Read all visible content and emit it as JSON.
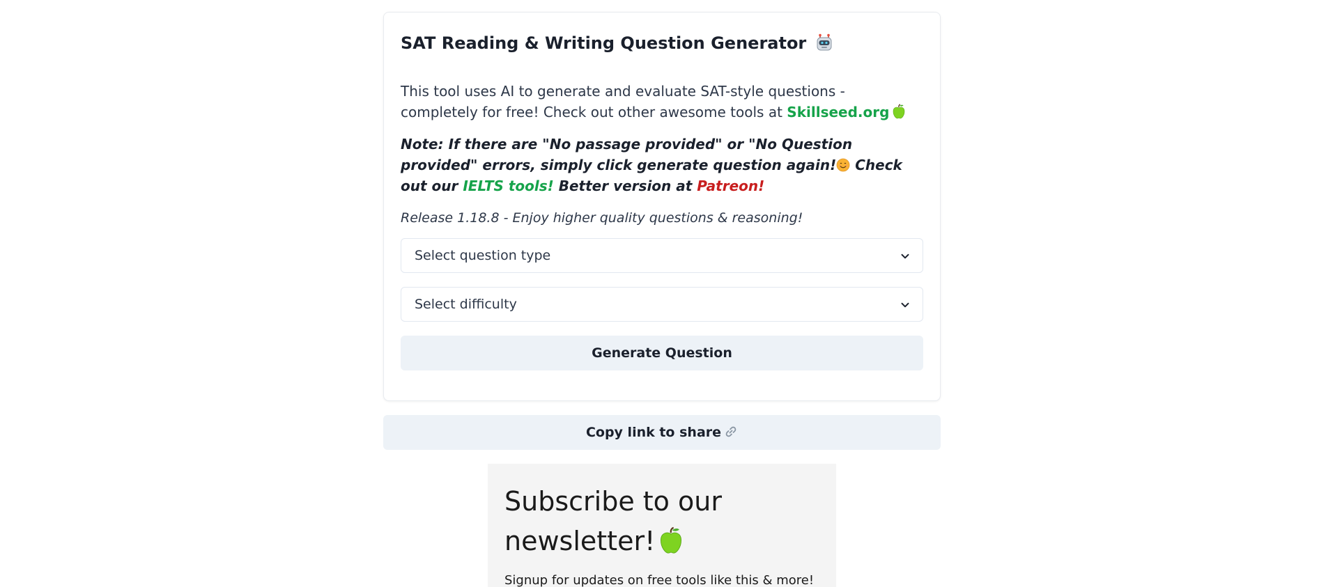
{
  "card": {
    "title": "SAT Reading & Writing Question Generator",
    "title_icon": "robot-icon",
    "intro_text": "This tool uses AI to generate and evaluate SAT-style questions - completely for free! Check out other awesome tools at",
    "brand_link": "Skillseed.org",
    "brand_icon": "green-apple-icon",
    "note_part1": "Note: If there are \"No passage provided\" or \"No Question provided\" errors, simply click generate question again!",
    "note_icon": "smiling-face-icon",
    "note_part2": "Check out our",
    "ielts_link": "IELTS tools!",
    "note_part3": "Better version at",
    "patreon_link": "Patreon!",
    "release_text": "Release 1.18.8 - Enjoy higher quality questions & reasoning!",
    "question_type_select": {
      "selected": "Select question type"
    },
    "difficulty_select": {
      "selected": "Select difficulty"
    },
    "generate_button_label": "Generate Question"
  },
  "share": {
    "label": "Copy link to share",
    "icon": "link-icon"
  },
  "newsletter": {
    "title": "Subscribe to our newsletter!",
    "title_icon": "green-apple-icon",
    "subtitle": "Signup for updates on free tools like this & more!"
  },
  "colors": {
    "brand_green": "#16a34a",
    "patreon_red": "#c81e1e",
    "button_bg": "#edf2f7",
    "newsletter_bg": "#f4f4f4"
  }
}
